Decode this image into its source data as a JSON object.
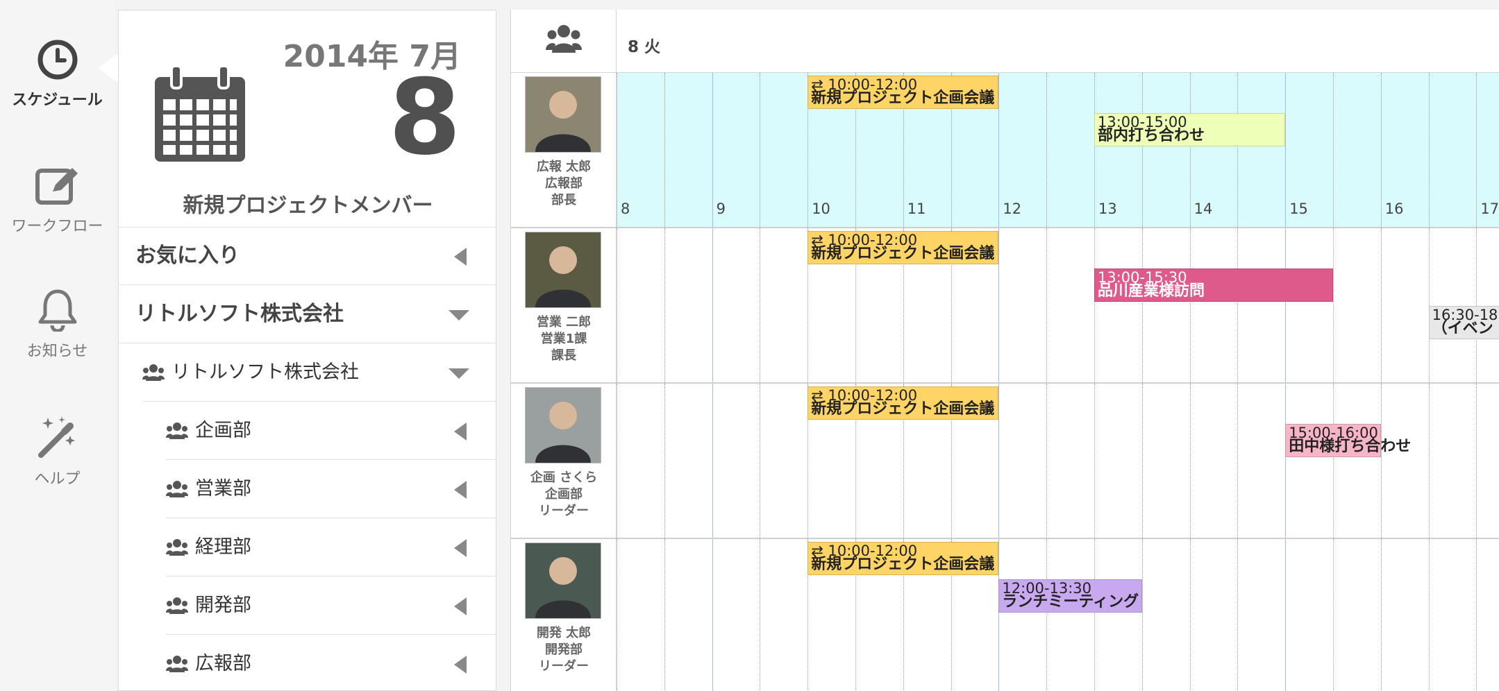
{
  "nav": [
    {
      "label": "スケジュール",
      "icon": "clock-icon",
      "active": true
    },
    {
      "label": "ワークフロー",
      "icon": "edit-icon"
    },
    {
      "label": "お知らせ",
      "icon": "bell-icon"
    },
    {
      "label": "ヘルプ",
      "icon": "magic-wand-icon"
    }
  ],
  "date_card": {
    "year_month": "2014年 7月",
    "day": "8",
    "group_name": "新規プロジェクトメンバー"
  },
  "sidebar": {
    "favorites": "お気に入り",
    "company": "リトルソフト株式会社",
    "company_group": "リトルソフト株式会社",
    "departments": [
      "企画部",
      "営業部",
      "経理部",
      "開発部",
      "広報部"
    ]
  },
  "schedule": {
    "date_header": "8 火",
    "hours": [
      "8",
      "9",
      "10",
      "11",
      "12",
      "13",
      "14",
      "15",
      "16",
      "17"
    ],
    "members": [
      {
        "name": "広報 太郎",
        "dept": "広報部",
        "title": "部長",
        "events": [
          {
            "time": "10:00-12:00",
            "name": "新規プロジェクト企画会議",
            "color": "#ffd466",
            "repeat": true
          },
          {
            "time": "13:00-15:00",
            "name": "部内打ち合わせ",
            "color": "#eeffb8"
          }
        ]
      },
      {
        "name": "営業 二郎",
        "dept": "営業1課",
        "title": "課長",
        "events": [
          {
            "time": "10:00-12:00",
            "name": "新規プロジェクト企画会議",
            "color": "#ffd466",
            "repeat": true
          },
          {
            "time": "13:00-15:30",
            "name": "品川産業様訪問",
            "color": "#de5a8a"
          },
          {
            "time": "16:30-18:",
            "name": "（イベン",
            "color": "#e8e8e8"
          }
        ]
      },
      {
        "name": "企画 さくら",
        "dept": "企画部",
        "title": "リーダー",
        "events": [
          {
            "time": "10:00-12:00",
            "name": "新規プロジェクト企画会議",
            "color": "#ffd466",
            "repeat": true
          },
          {
            "time": "15:00-16:00",
            "name": "田中様打ち合わせ",
            "color": "#f8b5c8"
          }
        ]
      },
      {
        "name": "開発 太郎",
        "dept": "開発部",
        "title": "リーダー",
        "events": [
          {
            "time": "10:00-12:00",
            "name": "新規プロジェクト企画会議",
            "color": "#ffd466",
            "repeat": true
          },
          {
            "time": "12:00-13:30",
            "name": "ランチミーティング",
            "color": "#c8a8ef"
          }
        ]
      }
    ]
  }
}
